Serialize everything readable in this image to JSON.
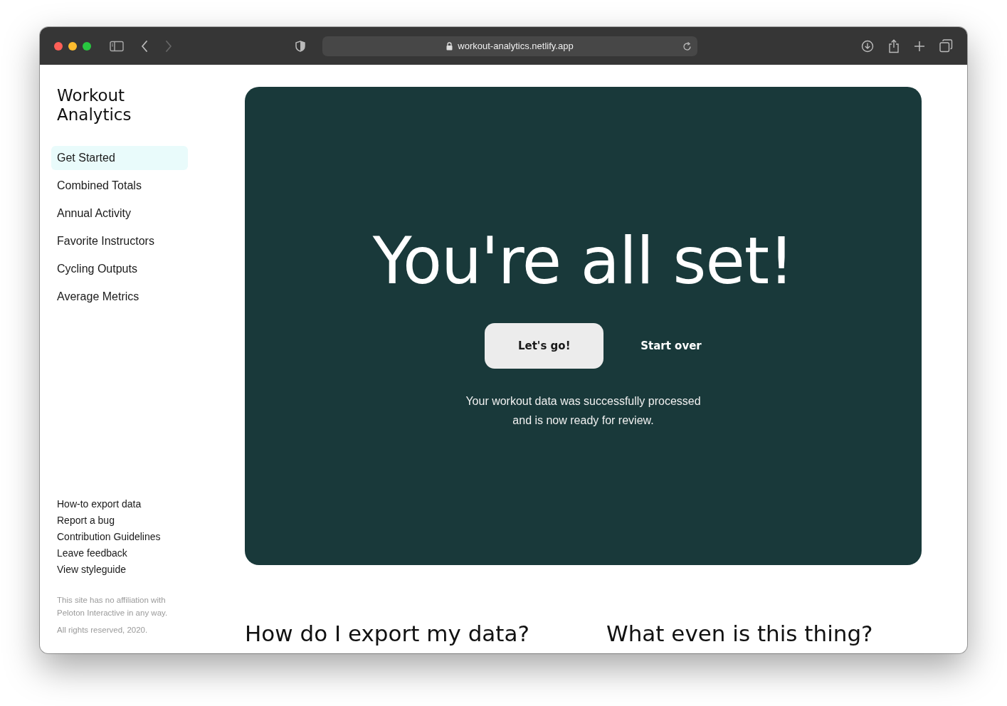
{
  "browser": {
    "url": "workout-analytics.netlify.app",
    "forward_disabled": true
  },
  "sidebar": {
    "title": "Workout Analytics",
    "nav": [
      {
        "label": "Get Started",
        "selected": true
      },
      {
        "label": "Combined Totals",
        "selected": false
      },
      {
        "label": "Annual Activity",
        "selected": false
      },
      {
        "label": "Favorite Instructors",
        "selected": false
      },
      {
        "label": "Cycling Outputs",
        "selected": false
      },
      {
        "label": "Average Metrics",
        "selected": false
      }
    ],
    "footer_links": [
      "How-to export data",
      "Report a bug",
      "Contribution Guidelines",
      "Leave feedback",
      "View styleguide"
    ],
    "disclaimer": "This site has no affiliation with Peloton Interactive in any way.",
    "copyright": "All rights reserved, 2020."
  },
  "hero": {
    "title": "You're all set!",
    "buttons": [
      {
        "label": "Let's go!",
        "kind": "primary"
      },
      {
        "label": "Start over",
        "kind": "text"
      }
    ],
    "description": "Your workout data was successfully processed and is now ready for review."
  },
  "sections": [
    {
      "heading": "How do I export my data?"
    },
    {
      "heading": "What even is this thing?"
    }
  ]
}
